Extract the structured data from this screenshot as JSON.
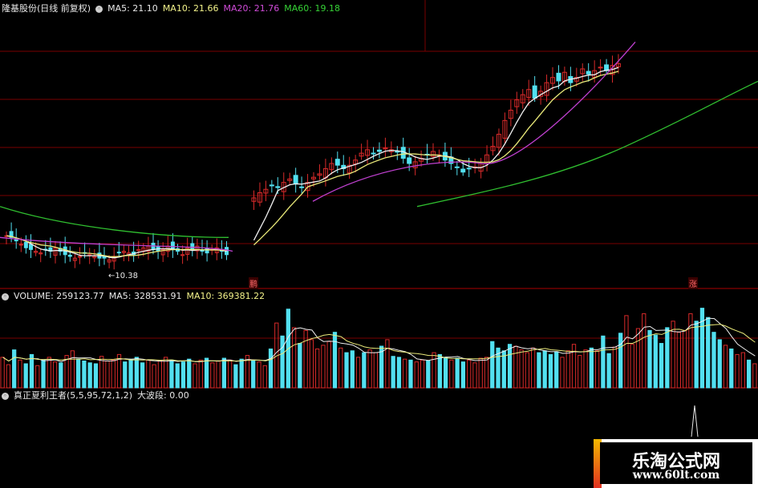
{
  "price_header": {
    "title": "隆基股份(日线 前复权)",
    "ma5": "MA5: 21.10",
    "ma10": "MA10: 21.66",
    "ma20": "MA20: 21.76",
    "ma60": "MA60: 19.18"
  },
  "volume_header": {
    "vol": "VOLUME: 259123.77",
    "ma5": "MA5: 328531.91",
    "ma10": "MA10: 369381.22"
  },
  "indicator_header": {
    "name": "真正夏利王者(5,5,95,72,1,2)",
    "value": "大波段: 0.00"
  },
  "low_label": "←10.38",
  "tags": {
    "left": "鹏",
    "right": "涨"
  },
  "watermark": {
    "title": "乐淘公式网",
    "url": "www.60lt.com"
  },
  "colors": {
    "up": "#d82a2a",
    "down": "#52e0f0",
    "ma5": "#f0f0f0",
    "ma10": "#eaea7a",
    "ma20": "#c040d0",
    "ma60": "#30c030",
    "grid": "#7a0000"
  },
  "chart_data": [
    {
      "type": "candlestick",
      "title": "隆基股份(日线 前复权)",
      "series": [
        {
          "name": "MA5",
          "last": 21.1
        },
        {
          "name": "MA10",
          "last": 21.66
        },
        {
          "name": "MA20",
          "last": 21.76
        },
        {
          "name": "MA60",
          "last": 19.18
        }
      ],
      "annotations": [
        "10.38"
      ],
      "gap_after_index": 45,
      "ma20": {
        "start": 12.0,
        "end": 21.76
      },
      "ma60": {
        "start": 13.8,
        "end": 19.18
      },
      "close": [
        12.1,
        12.0,
        11.8,
        11.6,
        11.4,
        11.3,
        11.2,
        11.1,
        11.3,
        11.2,
        11.4,
        11.2,
        11.0,
        10.9,
        10.8,
        10.9,
        11.1,
        11.0,
        10.9,
        10.8,
        10.8,
        10.7,
        10.9,
        11.1,
        11.2,
        11.1,
        11.0,
        11.3,
        11.4,
        11.5,
        11.3,
        11.2,
        11.3,
        11.5,
        11.3,
        11.2,
        11.0,
        11.4,
        11.3,
        11.5,
        11.2,
        11.1,
        11.3,
        11.4,
        11.2,
        11.0,
        14.3,
        14.6,
        14.8,
        15.0,
        14.9,
        15.2,
        15.4,
        15.1,
        14.9,
        15.2,
        15.5,
        15.7,
        16.0,
        16.3,
        16.2,
        16.0,
        16.2,
        16.5,
        16.9,
        17.1,
        16.9,
        17.0,
        17.2,
        17.1,
        17.0,
        16.6,
        16.3,
        16.4,
        16.6,
        16.8,
        17.0,
        16.8,
        16.5,
        16.3,
        16.1,
        15.8,
        16.0,
        16.1,
        16.3,
        16.8,
        17.3,
        18.0,
        18.8,
        19.4,
        20.0,
        20.3,
        20.6,
        20.1,
        20.5,
        21.0,
        21.3,
        21.1,
        21.6,
        21.0,
        21.3,
        21.8,
        21.5,
        21.7,
        21.9,
        21.7,
        22.0,
        22.1
      ],
      "volume": [
        330000,
        250000,
        410000,
        300000,
        260000,
        360000,
        240000,
        300000,
        330000,
        280000,
        270000,
        350000,
        400000,
        310000,
        290000,
        270000,
        260000,
        340000,
        290000,
        300000,
        360000,
        280000,
        310000,
        330000,
        270000,
        300000,
        250000,
        290000,
        330000,
        300000,
        260000,
        280000,
        310000,
        260000,
        300000,
        320000,
        270000,
        290000,
        320000,
        300000,
        250000,
        310000,
        350000,
        300000,
        280000,
        240000,
        420000,
        700000,
        560000,
        850000,
        650000,
        480000,
        620000,
        520000,
        420000,
        460000,
        500000,
        600000,
        430000,
        380000,
        400000,
        330000,
        380000,
        410000,
        380000,
        450000,
        520000,
        340000,
        330000,
        310000,
        300000,
        280000,
        300000,
        290000,
        380000,
        360000,
        330000,
        300000,
        320000,
        280000,
        300000,
        270000,
        320000,
        330000,
        500000,
        430000,
        400000,
        470000,
        450000,
        410000,
        380000,
        430000,
        380000,
        400000,
        360000,
        390000,
        330000,
        400000,
        470000,
        350000,
        410000,
        430000,
        400000,
        560000,
        370000,
        440000,
        590000,
        780000,
        470000,
        640000,
        800000,
        620000,
        570000,
        480000,
        650000,
        720000,
        600000,
        620000,
        800000,
        720000,
        860000,
        760000,
        600000,
        520000,
        460000,
        420000,
        360000,
        380000,
        300000,
        260000
      ]
    },
    {
      "type": "line",
      "title": "真正夏利王者(5,5,95,72,1,2)",
      "series": [
        {
          "name": "大波段",
          "last": 0.0
        }
      ]
    }
  ]
}
